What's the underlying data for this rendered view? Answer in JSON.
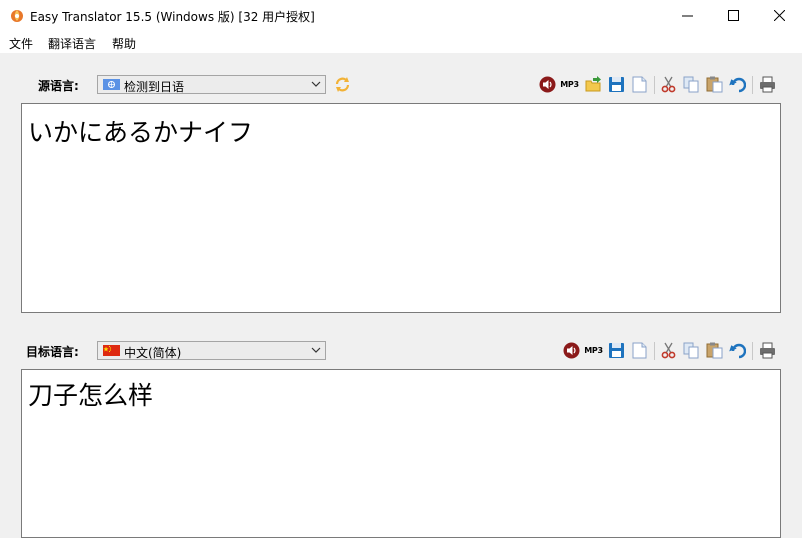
{
  "window": {
    "title": "Easy Translator 15.5 (Windows 版) [32 用户授权]"
  },
  "menu": {
    "items": [
      "文件",
      "翻译语言",
      "帮助"
    ]
  },
  "source": {
    "label": "源语言:",
    "language": "检测到日语",
    "flag_icon": "un-flag-icon",
    "text": "いかにあるかナイフ"
  },
  "target": {
    "label": "目标语言:",
    "language": "中文(简体)",
    "flag_icon": "china-flag-icon",
    "text": "刀子怎么样"
  },
  "toolbar": {
    "mp3_label": "MP3"
  },
  "colors": {
    "accent_red": "#c0392b",
    "accent_blue": "#1e73be",
    "background": "#f0f0f0"
  }
}
